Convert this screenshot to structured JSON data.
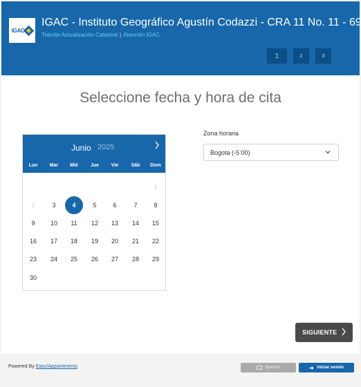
{
  "header": {
    "logo_text": "IGAC",
    "title": "IGAC - Instituto Geográfico Agustín Codazzi - CRA 11 No. 11 - 69",
    "subtitle_left": "Trámite Actualización Catastral",
    "subtitle_sep": "|",
    "subtitle_right": "Atención IGAC",
    "steps": [
      "1",
      "2",
      "3"
    ],
    "active_step": "1"
  },
  "page_title": "Seleccione fecha y hora de cita",
  "calendar": {
    "month": "Junio",
    "year": "2025",
    "next_icon": "chevron-right-icon",
    "weekdays": [
      "Lun",
      "Mar",
      "Mié",
      "Jue",
      "Vie",
      "Sáb",
      "Dom"
    ],
    "days": [
      {
        "label": "1",
        "state": "disabled"
      },
      {
        "label": "2",
        "state": "disabled"
      },
      {
        "label": "3",
        "state": "available"
      },
      {
        "label": "4",
        "state": "selected"
      },
      {
        "label": "5",
        "state": "available"
      },
      {
        "label": "6",
        "state": "available"
      },
      {
        "label": "7",
        "state": "available"
      },
      {
        "label": "8",
        "state": "available"
      },
      {
        "label": "9",
        "state": "available"
      },
      {
        "label": "10",
        "state": "available"
      },
      {
        "label": "11",
        "state": "available"
      },
      {
        "label": "12",
        "state": "available"
      },
      {
        "label": "13",
        "state": "available"
      },
      {
        "label": "14",
        "state": "available"
      },
      {
        "label": "15",
        "state": "available"
      },
      {
        "label": "16",
        "state": "available"
      },
      {
        "label": "17",
        "state": "available"
      },
      {
        "label": "18",
        "state": "available"
      },
      {
        "label": "19",
        "state": "available"
      },
      {
        "label": "20",
        "state": "available"
      },
      {
        "label": "21",
        "state": "available"
      },
      {
        "label": "22",
        "state": "available"
      },
      {
        "label": "23",
        "state": "available"
      },
      {
        "label": "24",
        "state": "available"
      },
      {
        "label": "25",
        "state": "available"
      },
      {
        "label": "26",
        "state": "available"
      },
      {
        "label": "27",
        "state": "available"
      },
      {
        "label": "28",
        "state": "available"
      },
      {
        "label": "29",
        "state": "available"
      },
      {
        "label": "30",
        "state": "available"
      }
    ],
    "first_day_weekday_index": 6,
    "selected_color": "#1767aa"
  },
  "timezone": {
    "label": "Zona horaria",
    "value": "Bogota (-5:00)"
  },
  "next_button": {
    "label": "SIGUIENTE",
    "icon": "chevron-right-icon"
  },
  "footer": {
    "powered_prefix": "Powered By",
    "powered_link": "Easy!Appointments",
    "language_button": "Spanish",
    "login_button": "Iniciar sesión"
  },
  "colors": {
    "primary": "#1767aa",
    "header_step_bg": "#0b4f87",
    "accent_subtitle": "#63d1f2",
    "next_button_bg": "#4a4a4a"
  }
}
